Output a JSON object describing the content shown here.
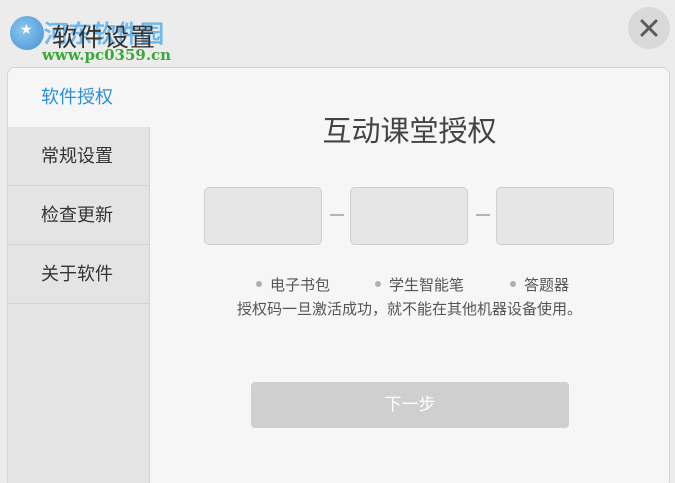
{
  "window": {
    "title": "软件设置",
    "watermark_text": "河东软件园",
    "watermark_url": "www.pc0359.cn"
  },
  "sidebar": {
    "items": [
      {
        "label": "软件授权",
        "active": true
      },
      {
        "label": "常规设置",
        "active": false
      },
      {
        "label": "检查更新",
        "active": false
      },
      {
        "label": "关于软件",
        "active": false
      }
    ]
  },
  "main": {
    "title": "互动课堂授权",
    "code_fields": [
      "",
      "",
      ""
    ],
    "devices": [
      "电子书包",
      "学生智能笔",
      "答题器"
    ],
    "notice": "授权码一旦激活成功，就不能在其他机器设备使用。",
    "next_label": "下一步"
  },
  "colors": {
    "accent": "#2b8fd6",
    "background": "#ececec",
    "panel": "#f6f6f6",
    "button_disabled": "#cfcfcf"
  },
  "icons": {
    "close": "close-icon",
    "logo": "site-logo-icon",
    "bullet": "bullet-dot-icon"
  }
}
